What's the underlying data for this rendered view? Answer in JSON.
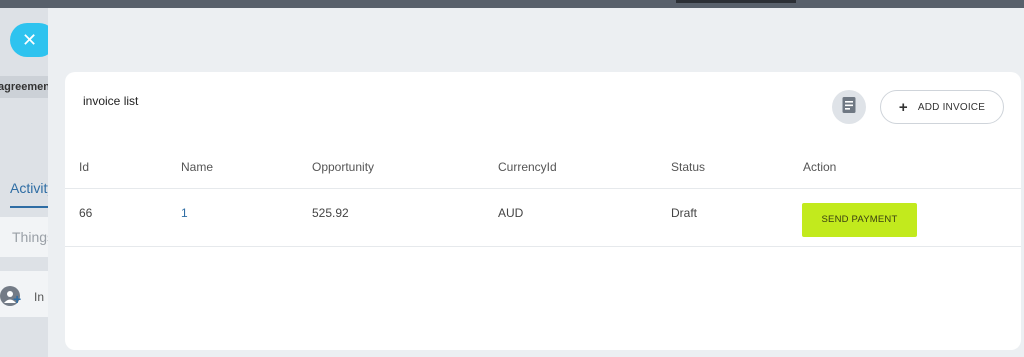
{
  "background": {
    "close_glyph": "✕",
    "agreement_tab": "agreement",
    "activity_tab": "Activity",
    "things_placeholder": "Things",
    "row_label": "In"
  },
  "panel": {
    "title": "invoice list",
    "notes_icon": "document-icon",
    "add_invoice_label": "ADD INVOICE",
    "add_icon": "plus-icon"
  },
  "table": {
    "headers": [
      "Id",
      "Name",
      "Opportunity",
      "CurrencyId",
      "Status",
      "Action"
    ],
    "rows": [
      {
        "id": "66",
        "name": "1",
        "opportunity": "525.92",
        "currency": "AUD",
        "status": "Draft",
        "action_label": "SEND PAYMENT"
      }
    ]
  },
  "colors": {
    "accent_green": "#c2ea1d",
    "link_blue": "#2e6da4",
    "close_blue": "#2ec3ef"
  }
}
